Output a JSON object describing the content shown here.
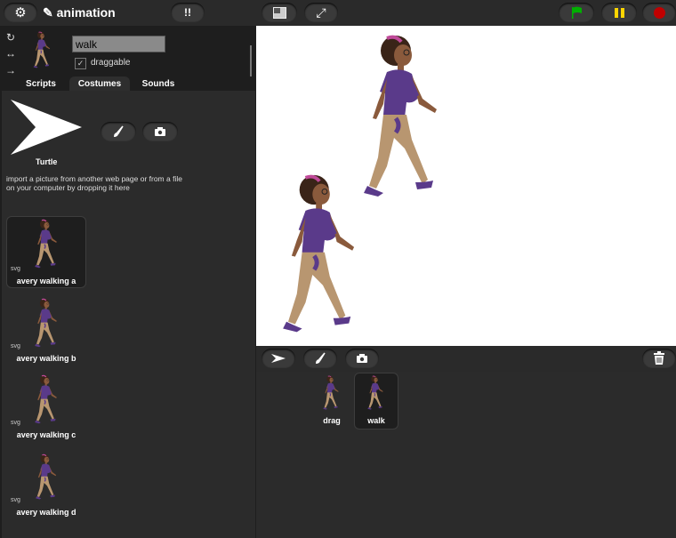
{
  "topbar": {
    "project_title": "✎ animation",
    "settings_icon": "gear-icon",
    "stage_size_icon": "stage-size-icon",
    "fullscreen_icon": "fullscreen-icon",
    "green_flag_icon": "green-flag-icon",
    "pause_icon": "pause-icon",
    "stop_icon": "stop-icon",
    "colors": {
      "flag": "#00b000",
      "pause": "#ffd500",
      "stop": "#c00000"
    }
  },
  "sprite": {
    "name": "walk",
    "draggable_label": "draggable",
    "draggable_checked": "✓"
  },
  "tabs": [
    {
      "label": "Scripts"
    },
    {
      "label": "Costumes"
    },
    {
      "label": "Sounds"
    }
  ],
  "costumes_pane": {
    "turtle_label": "Turtle",
    "paint_icon": "paintbrush-icon",
    "camera_icon": "camera-icon",
    "import_text": "import a picture from another web page or from a file on your computer by dropping it here",
    "costumes": [
      {
        "type": "svg",
        "name": "avery walking a"
      },
      {
        "type": "svg",
        "name": "avery walking b"
      },
      {
        "type": "svg",
        "name": "avery walking c"
      },
      {
        "type": "svg",
        "name": "avery walking d"
      }
    ]
  },
  "corral": {
    "turtle_icon": "turtle-arrow-icon",
    "paint_icon": "paintbrush-icon",
    "camera_icon": "camera-icon",
    "trash_icon": "trash-icon",
    "sprites": [
      {
        "name": "drag"
      },
      {
        "name": "walk"
      }
    ]
  }
}
